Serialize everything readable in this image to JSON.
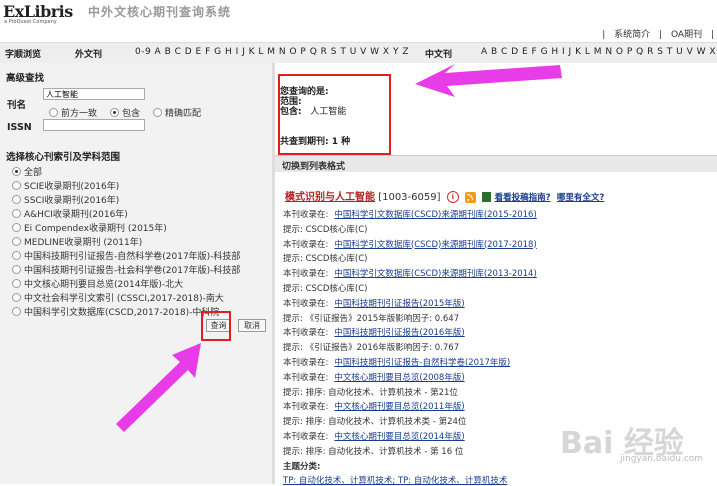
{
  "header": {
    "brand": "ExLibris",
    "brand_sub": "a ProQuest Company",
    "site_title": "中外文核心期刊查询系统",
    "links": [
      "|",
      "系统简介",
      "|",
      "OA期刊",
      "|"
    ]
  },
  "alphabar": {
    "browse_label": "字顺浏览",
    "foreign_label": "外文刊",
    "foreign_letters": "0-9 A B C D E F G H I J K L M N O P Q R S T U V W X Y Z",
    "chinese_label": "中文刊",
    "chinese_letters": "A B C D E F G H I J K L M N O P Q R S T U V W X Y Z"
  },
  "search": {
    "title": "高级查找",
    "journal_label": "刊名",
    "journal_value": "人工智能",
    "match_options": [
      "前方一致",
      "包含",
      "精确匹配"
    ],
    "match_selected": "包含",
    "issn_label": "ISSN",
    "issn_value": "",
    "scope_title": "选择核心刊索引及学科范围",
    "scopes": [
      "全部",
      "SCIE收录期刊(2016年)",
      "SSCI收录期刊(2016年)",
      "A&HCI收录期刊(2016年)",
      "Ei Compendex收录期刊 (2015年)",
      "MEDLINE收录期刊 (2011年)",
      "中国科技期刊引证报告-自然科学卷(2017年版)-科技部",
      "中国科技期刊引证报告-社会科学卷(2017年版)-科技部",
      "中文核心期刊要目总览(2014年版)-北大",
      "中文社会科学引文索引 (CSSCI,2017-2018)-南大",
      "中国科学引文数据库(CSCD,2017-2018)-中科院"
    ],
    "scope_selected": "全部",
    "query_button": "查询",
    "cancel_button": "取消"
  },
  "result": {
    "query_label": "您查询的是:",
    "range_label": "范围:",
    "contains_label": "包含:",
    "contains_value": "人工智能",
    "total_label": "共查到期刊: 1 种",
    "switch_label": "切换到列表格式",
    "journal_name": "模式识别与人工智能",
    "journal_issn": "[1003-6059]",
    "guide_link": "看看投稿指南?",
    "fulltext_link": "哪里有全文?",
    "lines": [
      {
        "prefix": "本刊收录在:",
        "link": "中国科学引文数据库(CSCD)来源期刊库(2015-2016)"
      },
      {
        "prefix": "提示: CSCD核心库(C)",
        "link": ""
      },
      {
        "prefix": "本刊收录在:",
        "link": "中国科学引文数据库(CSCD)来源期刊库(2017-2018)"
      },
      {
        "prefix": "提示: CSCD核心库(C)",
        "link": ""
      },
      {
        "prefix": "本刊收录在:",
        "link": "中国科学引文数据库(CSCD)来源期刊库(2013-2014)"
      },
      {
        "prefix": "提示: CSCD核心库(C)",
        "link": ""
      },
      {
        "prefix": "本刊收录在:",
        "link": "中国科技期刊引证报告(2015年版)"
      },
      {
        "prefix": "提示: 《引证报告》2015年版影响因子: 0.647",
        "link": ""
      },
      {
        "prefix": "本刊收录在:",
        "link": "中国科技期刊引证报告(2016年版)"
      },
      {
        "prefix": "提示: 《引证报告》2016年版影响因子: 0.767",
        "link": ""
      },
      {
        "prefix": "本刊收录在:",
        "link": "中国科技期刊引证报告-自然科学卷(2017年版)"
      },
      {
        "prefix": "本刊收录在:",
        "link": "中文核心期刊要目总览(2008年版)"
      },
      {
        "prefix": "提示: 排序: 自动化技术、计算机技术 - 第21位",
        "link": ""
      },
      {
        "prefix": "本刊收录在:",
        "link": "中文核心期刊要目总览(2011年版)"
      },
      {
        "prefix": "提示: 排序: 自动化技术、计算机技术类 - 第24位",
        "link": ""
      },
      {
        "prefix": "本刊收录在:",
        "link": "中文核心期刊要目总览(2014年版)"
      },
      {
        "prefix": "提示: 排序: 自动化技术、计算机技术 - 第 16 位",
        "link": ""
      },
      {
        "prefix": "主题分类:",
        "link": ""
      },
      {
        "prefix": "",
        "link": "TP: 自动化技术、计算机技术; TP: 自动化技术、计算机技术"
      }
    ]
  },
  "watermark": {
    "text": "Bai 经验",
    "sub": "jingyan.baidu.com"
  },
  "colors": {
    "annotation_box": "#e02020",
    "annotation_arrow": "#e83ce8",
    "journal_title": "#b22222"
  }
}
